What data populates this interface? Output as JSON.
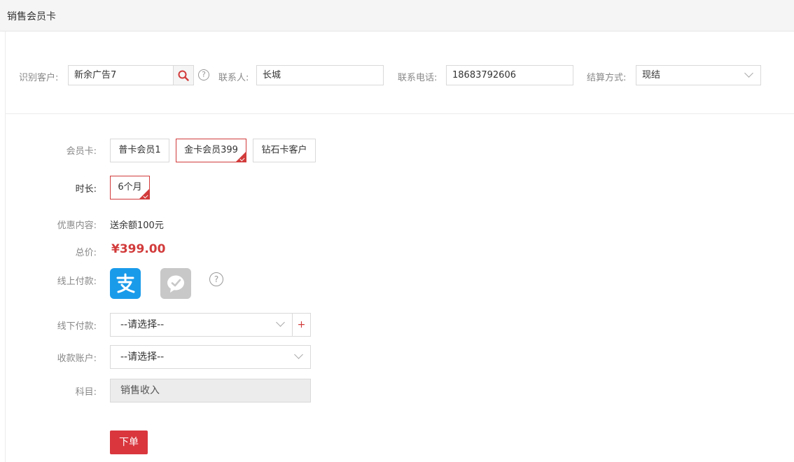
{
  "page": {
    "title": "销售会员卡"
  },
  "customer_row": {
    "customer_label": "识别客户:",
    "customer_value": "新余广告7",
    "contact_label": "联系人:",
    "contact_value": "长城",
    "phone_label": "联系电话:",
    "phone_value": "18683792606",
    "settlement_label": "结算方式:",
    "settlement_value": "现结",
    "help_glyph": "?"
  },
  "form": {
    "card_label": "会员卡:",
    "cards": [
      {
        "label": "普卡会员1",
        "selected": false
      },
      {
        "label": "金卡会员399",
        "selected": true
      },
      {
        "label": "钻石卡客户",
        "selected": false
      }
    ],
    "duration_label": "时长:",
    "durations": [
      {
        "label": "6个月",
        "selected": true
      }
    ],
    "discount_label": "优惠内容:",
    "discount_value": "送余额100元",
    "total_label": "总价:",
    "total_value": "¥399.00",
    "online_pay_label": "线上付款:",
    "online_pay_icons": [
      "alipay-icon",
      "wechat-pay-icon"
    ],
    "help_glyph": "?",
    "offline_pay_label": "线下付款:",
    "offline_pay_value": "--请选择--",
    "plus_glyph": "+",
    "account_label": "收款账户:",
    "account_value": "--请选择--",
    "subject_label": "科目:",
    "subject_value": "销售收入",
    "submit_label": "下单"
  },
  "colors": {
    "accent_red": "#d23b3b",
    "alipay_blue": "#1a9bea",
    "wechat_gray": "#c8c8c8"
  }
}
